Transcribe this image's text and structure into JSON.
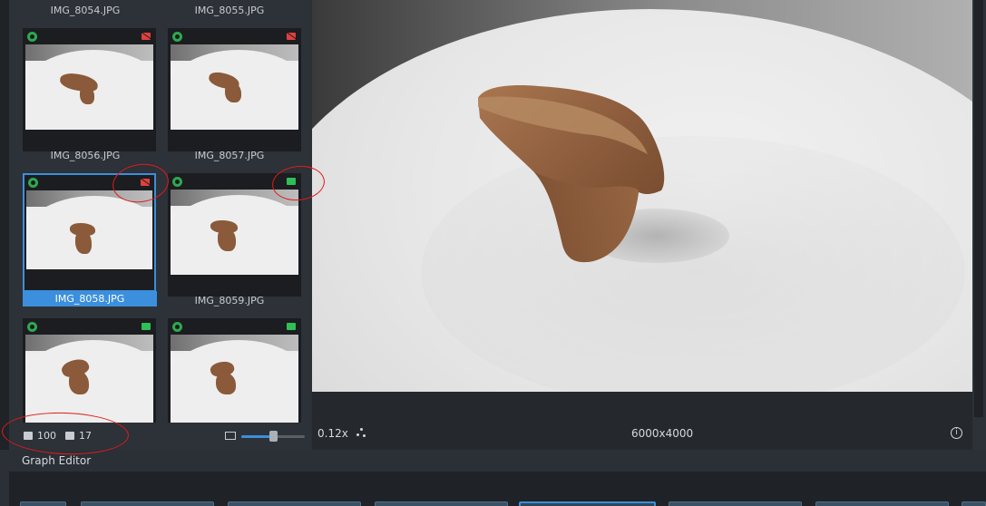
{
  "gallery": {
    "top_labels": [
      "IMG_8054.JPG",
      "IMG_8055.JPG"
    ],
    "thumbnails": [
      {
        "label": "IMG_8056.JPG",
        "camera": "off",
        "selected": false
      },
      {
        "label": "IMG_8057.JPG",
        "camera": "off",
        "selected": false
      },
      {
        "label": "IMG_8058.JPG",
        "camera": "off",
        "selected": true
      },
      {
        "label": "IMG_8059.JPG",
        "camera": "on",
        "selected": false
      },
      {
        "label": "",
        "camera": "on",
        "selected": false
      },
      {
        "label": "",
        "camera": "on",
        "selected": false
      }
    ],
    "footer": {
      "image_count": "100",
      "camera_count": "17",
      "thumbnail_size_percent": 50
    }
  },
  "viewer": {
    "zoom": "0.12x",
    "resolution": "6000x4000"
  },
  "graph_editor": {
    "title": "Graph Editor"
  },
  "colors": {
    "accent": "#3b8fdc",
    "camera_on": "#2fbf55",
    "camera_off": "#e0413f",
    "annotation": "#e21b1b"
  }
}
